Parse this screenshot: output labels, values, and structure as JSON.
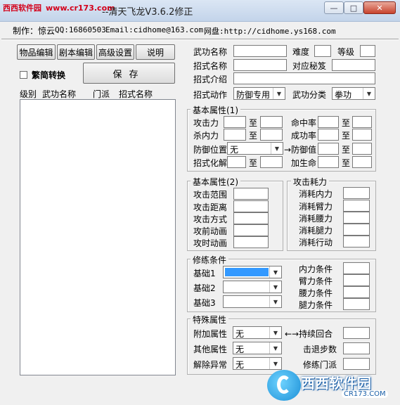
{
  "window": {
    "title": "--清天飞龙V3.6.2修正",
    "watermark_site": "西西软件园",
    "watermark_url": "www.cr173.com",
    "minimize_label": "—",
    "maximize_label": "□",
    "close_label": "✕"
  },
  "info": {
    "author": "制作：惊云",
    "qq": "QQ:16860503",
    "email": "Email:cidhome@163.com",
    "website": "网盘:http://cidhome.ys168.com"
  },
  "toolbar": {
    "item_edit": "物品编辑",
    "script_edit": "剧本编辑",
    "advanced": "高级设置",
    "help": "说明",
    "convert_label": "繁简转换",
    "save": "保存"
  },
  "list": {
    "columns": [
      "级别",
      "武功名称",
      "门派",
      "招式名称"
    ]
  },
  "skill": {
    "name_label": "武功名称",
    "difficulty_label": "难度",
    "level_label": "等级",
    "move_name_label": "招式名称",
    "secret_label": "对应秘笈",
    "move_intro_label": "招式介绍",
    "move_action_label": "招式动作",
    "move_action_value": "防御专用",
    "category_label": "武功分类",
    "category_value": "拳功"
  },
  "basic1": {
    "title": "基本属性(1)",
    "attack_label": "攻击力",
    "kill_inner_label": "杀内力",
    "defense_pos_label": "防御位置",
    "defense_pos_value": "无",
    "defense_value_label": "→防御值",
    "move_solve_label": "招式化解",
    "hit_rate_label": "命中率",
    "success_rate_label": "成功率",
    "life_label": "加生命",
    "to": "至"
  },
  "basic2": {
    "title": "基本属性(2)",
    "range_label": "攻击范围",
    "distance_label": "攻击距离",
    "mode_label": "攻击方式",
    "pre_anim_label": "攻前动画",
    "anim_label": "攻时动画"
  },
  "cost": {
    "title": "攻击耗力",
    "inner_label": "消耗内力",
    "arm_label": "消耗臂力",
    "waist_label": "消耗腰力",
    "leg_label": "消耗腿力",
    "action_label": "消耗行动"
  },
  "training": {
    "title": "修练条件",
    "base1_label": "基础1",
    "base2_label": "基础2",
    "base3_label": "基础3",
    "inner_cond_label": "内力条件",
    "arm_cond_label": "臂力条件",
    "waist_cond_label": "腰力条件",
    "leg_cond_label": "腿力条件"
  },
  "special": {
    "title": "特殊属性",
    "extra_label": "附加属性",
    "extra_value": "无",
    "duration_label": "←→持续回合",
    "other_label": "其他属性",
    "other_value": "无",
    "knockback_label": "击退步数",
    "remove_label": "解除异常",
    "remove_value": "无",
    "sect_label": "修练门派"
  },
  "watermark_bottom": {
    "text": "西西软件园",
    "url": "CR173.COM"
  }
}
